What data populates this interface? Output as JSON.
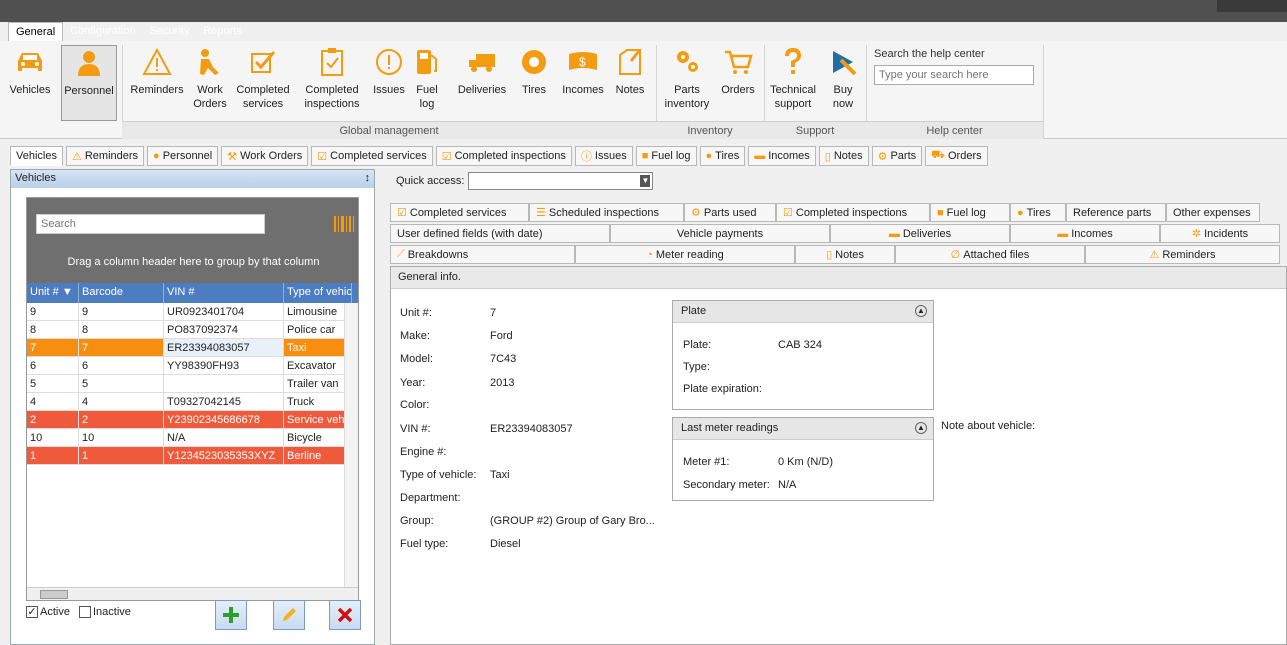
{
  "menu": {
    "tabs": [
      "General",
      "Configuration",
      "Security",
      "Reports"
    ]
  },
  "ribbon": {
    "buttons": [
      {
        "label": "Vehicles",
        "icon": "car-icon"
      },
      {
        "label": "Personnel",
        "icon": "person-icon"
      },
      {
        "label": "Reminders",
        "icon": "warning-icon"
      },
      {
        "label": "Work\nOrders",
        "icon": "worker-icon"
      },
      {
        "label": "Completed\nservices",
        "icon": "checkbox-icon"
      },
      {
        "label": "Completed\ninspections",
        "icon": "clipboard-icon"
      },
      {
        "label": "Issues",
        "icon": "exclamation-icon"
      },
      {
        "label": "Fuel\nlog",
        "icon": "fuel-pump-icon"
      },
      {
        "label": "Deliveries",
        "icon": "truck-icon"
      },
      {
        "label": "Tires",
        "icon": "tire-icon"
      },
      {
        "label": "Incomes",
        "icon": "money-icon"
      },
      {
        "label": "Notes",
        "icon": "note-icon"
      },
      {
        "label": "Parts\ninventory",
        "icon": "gears-icon"
      },
      {
        "label": "Orders",
        "icon": "cart-icon"
      },
      {
        "label": "Technical\nsupport",
        "icon": "question-icon"
      },
      {
        "label": "Buy\nnow",
        "icon": "buy-icon"
      }
    ],
    "groups": [
      "Global management",
      "Inventory",
      "Support",
      "Help center"
    ],
    "help_title": "Search the help center",
    "help_placeholder": "Type your search here"
  },
  "doc_tabs": [
    "Vehicles",
    "Reminders",
    "Personnel",
    "Work Orders",
    "Completed services",
    "Completed inspections",
    "Issues",
    "Fuel log",
    "Tires",
    "Incomes",
    "Notes",
    "Parts",
    "Orders"
  ],
  "left_panel": {
    "title": "Vehicles",
    "pin": "↕",
    "search_placeholder": "Search",
    "group_hint": "Drag a column header here to group by that column",
    "columns": [
      "Unit #",
      "Barcode",
      "VIN #",
      "Type of vehic"
    ],
    "rows": [
      [
        "9",
        "9",
        "UR0923401704",
        "Limousine"
      ],
      [
        "8",
        "8",
        "PO837092374",
        "Police car"
      ],
      [
        "7",
        "7",
        "ER23394083057",
        "Taxi"
      ],
      [
        "6",
        "6",
        "YY98390FH93",
        "Excavator"
      ],
      [
        "5",
        "5",
        "",
        "Trailer van"
      ],
      [
        "4",
        "4",
        "T09327042145",
        "Truck"
      ],
      [
        "2",
        "2",
        "Y23902345686678",
        "Service veh."
      ],
      [
        "10",
        "10",
        "N/A",
        "Bicycle"
      ],
      [
        "1",
        "1",
        "Y1234523035353XYZ",
        "Berline"
      ]
    ],
    "active_label": "Active",
    "inactive_label": "Inactive"
  },
  "right": {
    "quick_access_label": "Quick access:",
    "tabs_row1": [
      "Completed services",
      "Scheduled inspections",
      "Parts used",
      "Completed inspections",
      "Fuel log",
      "Tires",
      "Reference parts",
      "Other expenses"
    ],
    "tabs_row2": [
      "User defined fields (with date)",
      "Vehicle payments",
      "Deliveries",
      "Incomes",
      "Incidents"
    ],
    "tabs_row3": [
      "Breakdowns",
      "Meter reading",
      "Notes",
      "Attached files",
      "Reminders"
    ],
    "section_title": "General info.",
    "fields": [
      {
        "label": "Unit #:",
        "value": "7"
      },
      {
        "label": "Make:",
        "value": "Ford"
      },
      {
        "label": "Model:",
        "value": "7C43"
      },
      {
        "label": "Year:",
        "value": "2013"
      },
      {
        "label": "Color:",
        "value": ""
      },
      {
        "label": "VIN #:",
        "value": "ER23394083057"
      },
      {
        "label": "Engine #:",
        "value": ""
      },
      {
        "label": "Type of vehicle:",
        "value": "Taxi"
      },
      {
        "label": "Department:",
        "value": ""
      },
      {
        "label": "Group:",
        "value": "(GROUP #2) Group of Gary Bro..."
      },
      {
        "label": "Fuel type:",
        "value": "Diesel"
      }
    ],
    "plate": {
      "title": "Plate",
      "plate_label": "Plate:",
      "plate_value": "CAB 324",
      "type_label": "Type:",
      "exp_label": "Plate expiration:"
    },
    "meter": {
      "title": "Last meter readings",
      "m1_label": "Meter #1:",
      "m1_value": "0 Km (N/D)",
      "sec_label": "Secondary meter:",
      "sec_value": "N/A"
    },
    "note_label": "Note about vehicle:"
  },
  "colors": {
    "orange": "#f78e0f",
    "red": "#f05a3c",
    "header_blue": "#4b7dc0",
    "icon_orange": "#f39c12"
  }
}
